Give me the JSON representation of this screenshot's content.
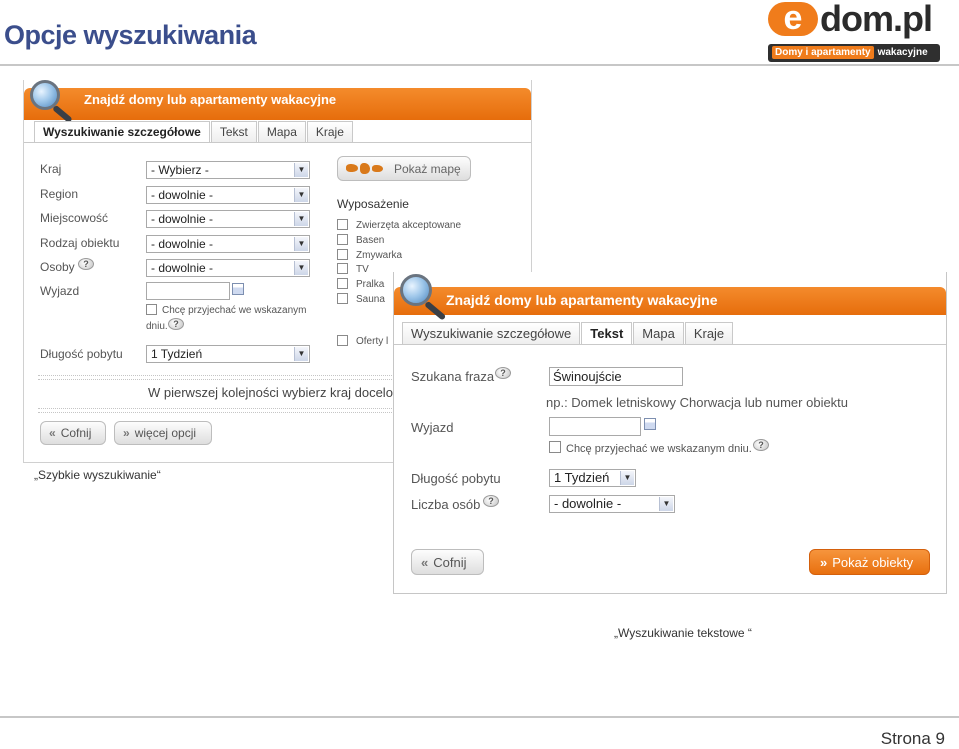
{
  "slide": {
    "title": "Opcje wyszukiwania",
    "page_number": "Strona 9"
  },
  "logo": {
    "main": "dom.pl",
    "letter": "e",
    "tagline_a": "Domy i apartamenty",
    "tagline_b": "wakacyjne",
    "colors": {
      "orange": "#f07c1b",
      "dark": "#2f2f2f"
    }
  },
  "detailed_panel": {
    "header": "Znajdź domy lub apartamenty wakacyjne",
    "tabs": [
      "Wyszukiwanie szczegółowe",
      "Tekst",
      "Mapa",
      "Kraje"
    ],
    "active_tab": "Wyszukiwanie szczegółowe",
    "fields": {
      "country_label": "Kraj",
      "country_value": "- Wybierz -",
      "region_label": "Region",
      "region_value": "- dowolnie -",
      "place_label": "Miejscowość",
      "place_value": "- dowolnie -",
      "type_label": "Rodzaj obiektu",
      "type_value": "- dowolnie -",
      "persons_label": "Osoby",
      "persons_value": "- dowolnie -",
      "departure_label": "Wyjazd",
      "departure_value": "",
      "exact_days_line1": "Chcę przyjechać we wskazanym",
      "exact_days_line2": "dniu.",
      "stay_label": "Długość pobytu",
      "stay_value": "1 Tydzień"
    },
    "map_button": "Pokaż mapę",
    "equipment_title": "Wyposażenie",
    "equipment": [
      "Zwierzęta akceptowane",
      "Basen",
      "Zmywarka",
      "TV",
      "Pralka",
      "Sauna"
    ],
    "offers_label": "Oferty l",
    "hint": "W pierwszej kolejności wybierz kraj docelo",
    "back_button": "Cofnij",
    "more_button": "więcej opcji",
    "caption": "„Szybkie wyszukiwanie“"
  },
  "text_panel": {
    "header": "Znajdź domy lub apartamenty wakacyjne",
    "tabs": [
      "Wyszukiwanie szczegółowe",
      "Tekst",
      "Mapa",
      "Kraje"
    ],
    "active_tab": "Tekst",
    "phrase_label": "Szukana fraza",
    "phrase_value": "Świnoujście",
    "example": "np.: Domek letniskowy Chorwacja lub numer obiektu",
    "departure_label": "Wyjazd",
    "departure_value": "",
    "exact_days": "Chcę przyjechać we wskazanym dniu.",
    "stay_label": "Długość pobytu",
    "stay_value": "1 Tydzień",
    "persons_label": "Liczba osób",
    "persons_value": "- dowolnie -",
    "back_button": "Cofnij",
    "show_button": "Pokaż obiekty",
    "caption": "„Wyszukiwanie tekstowe “"
  },
  "colors": {
    "accent_orange": "#ee7d1c",
    "title_blue": "#3b4e8c"
  }
}
